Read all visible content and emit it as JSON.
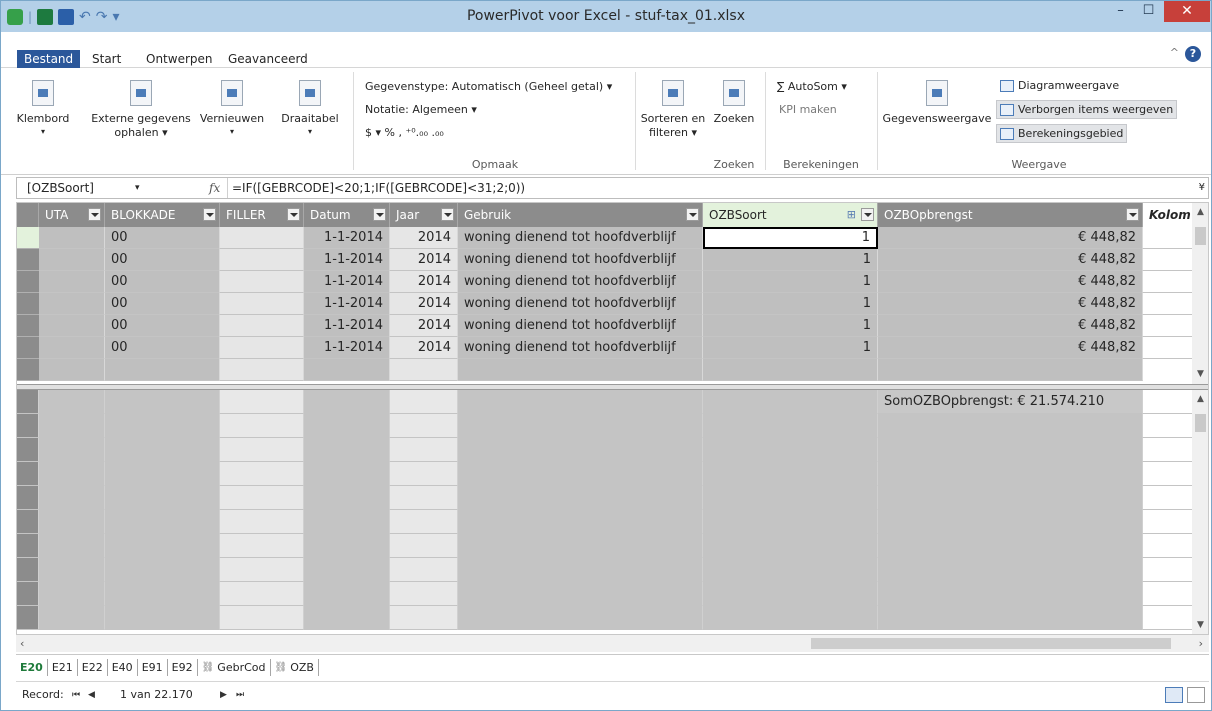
{
  "window": {
    "title": "PowerPivot voor Excel - stuf-tax_01.xlsx",
    "minimize": "–",
    "maximize": "☐",
    "close": "✕"
  },
  "qat": {
    "undo": "↶",
    "redo": "↷",
    "customize": "▾"
  },
  "tabs": [
    {
      "label": "Bestand"
    },
    {
      "label": "Start"
    },
    {
      "label": "Ontwerpen"
    },
    {
      "label": "Geavanceerd"
    }
  ],
  "ribbon": {
    "clipboard": {
      "label": "Klembord",
      "dd": "▾"
    },
    "external": {
      "line1": "Externe gegevens",
      "line2": "ophalen ▾"
    },
    "refresh": {
      "label": "Vernieuwen",
      "dd": "▾"
    },
    "pivot": {
      "label": "Draaitabel",
      "dd": "▾"
    },
    "format": {
      "datatype": "Gegevenstype: Automatisch (Geheel getal) ▾",
      "notation": "Notatie: Algemeen ▾",
      "symbols": "$ ▾ %  ,  ⁺⁰.₀₀  .₀₀",
      "group_label": "Opmaak"
    },
    "sort": {
      "line1": "Sorteren en",
      "line2": "filteren ▾"
    },
    "find": {
      "label": "Zoeken",
      "group_label": "Zoeken"
    },
    "calc": {
      "autosum": "∑ AutoSom ▾",
      "kpi": "KPI maken",
      "group_label": "Berekeningen"
    },
    "view": {
      "data_view": "Gegevensweergave",
      "diagram": "Diagramweergave",
      "hidden": "Verborgen items weergeven",
      "calc_area": "Berekeningsgebied",
      "group_label": "Weergave"
    }
  },
  "formula_bar": {
    "name_box": "[OZBSoort]",
    "name_arrow": "▾",
    "fx": "fx",
    "formula": "=IF([GEBRCODE]<20;1;IF([GEBRCODE]<31;2;0))",
    "expand": "¥"
  },
  "columns": [
    {
      "label": "UTA"
    },
    {
      "label": "BLOKKADE"
    },
    {
      "label": "FILLER"
    },
    {
      "label": "Datum"
    },
    {
      "label": "Jaar"
    },
    {
      "label": "Gebruik"
    },
    {
      "label": "OZBSoort"
    },
    {
      "label": "OZBOpbrengst"
    },
    {
      "label": "Kolom"
    }
  ],
  "rows": [
    {
      "uta": "",
      "blokkade": "00",
      "filler": "",
      "datum": "1-1-2014",
      "jaar": "2014",
      "gebruik": "woning dienend tot hoofdverblijf",
      "ozbsoort": "1",
      "ozbopbrengst": "€ 448,82"
    },
    {
      "uta": "",
      "blokkade": "00",
      "filler": "",
      "datum": "1-1-2014",
      "jaar": "2014",
      "gebruik": "woning dienend tot hoofdverblijf",
      "ozbsoort": "1",
      "ozbopbrengst": "€ 448,82"
    },
    {
      "uta": "",
      "blokkade": "00",
      "filler": "",
      "datum": "1-1-2014",
      "jaar": "2014",
      "gebruik": "woning dienend tot hoofdverblijf",
      "ozbsoort": "1",
      "ozbopbrengst": "€ 448,82"
    },
    {
      "uta": "",
      "blokkade": "00",
      "filler": "",
      "datum": "1-1-2014",
      "jaar": "2014",
      "gebruik": "woning dienend tot hoofdverblijf",
      "ozbsoort": "1",
      "ozbopbrengst": "€ 448,82"
    },
    {
      "uta": "",
      "blokkade": "00",
      "filler": "",
      "datum": "1-1-2014",
      "jaar": "2014",
      "gebruik": "woning dienend tot hoofdverblijf",
      "ozbsoort": "1",
      "ozbopbrengst": "€ 448,82"
    },
    {
      "uta": "",
      "blokkade": "00",
      "filler": "",
      "datum": "1-1-2014",
      "jaar": "2014",
      "gebruik": "woning dienend tot hoofdverblijf",
      "ozbsoort": "1",
      "ozbopbrengst": "€ 448,82"
    }
  ],
  "calc_area": {
    "measure": "SomOZBOpbrengst: € 21.574.210"
  },
  "sheets": [
    {
      "label": "E20",
      "linked": false
    },
    {
      "label": "E21",
      "linked": false
    },
    {
      "label": "E22",
      "linked": false
    },
    {
      "label": "E40",
      "linked": false
    },
    {
      "label": "E91",
      "linked": false
    },
    {
      "label": "E92",
      "linked": false
    },
    {
      "label": "GebrCod",
      "linked": true
    },
    {
      "label": "OZB",
      "linked": true
    }
  ],
  "status": {
    "record_label": "Record:",
    "first": "⏮",
    "prev": "◀",
    "position": "1 van 22.170",
    "next": "▶",
    "last": "⏭"
  }
}
